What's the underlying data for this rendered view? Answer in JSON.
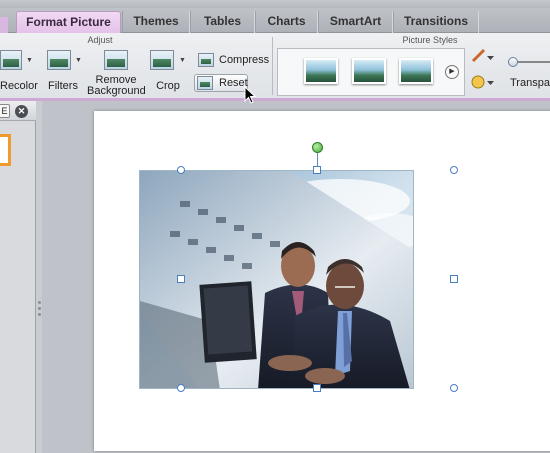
{
  "tabs": [
    {
      "label": "Format Picture",
      "active": true
    },
    {
      "label": "Themes"
    },
    {
      "label": "Tables"
    },
    {
      "label": "Charts"
    },
    {
      "label": "SmartArt"
    },
    {
      "label": "Transitions"
    }
  ],
  "ribbon": {
    "adjust": {
      "group_label": "Adjust",
      "recolor_label": "Recolor",
      "filters_label": "Filters",
      "remove_background_line1": "Remove",
      "remove_background_line2": "Background",
      "crop_label": "Crop",
      "compress_label": "Compress",
      "reset_label": "Reset"
    },
    "picture_styles": {
      "group_label": "Picture Styles",
      "transparency_label": "Transpa"
    }
  },
  "left_pane": {
    "tab_glyph": "E",
    "close_glyph": "✕"
  },
  "icons": [
    "recolor-icon",
    "filters-icon",
    "remove-background-icon",
    "crop-icon",
    "compress-icon",
    "reset-icon",
    "picture-style-thumbnail",
    "gallery-next-icon",
    "picture-border-icon",
    "picture-effects-icon",
    "transparency-slider",
    "close-icon",
    "rotate-handle",
    "mouse-pointer-icon"
  ],
  "colors": {
    "active_tab": "#e4c2e8",
    "ribbon_accent": "#cfa9d6",
    "selection_handle": "#4a7fc1",
    "rotate_handle": "#45a83a",
    "thumbnail_highlight": "#f0992f"
  }
}
